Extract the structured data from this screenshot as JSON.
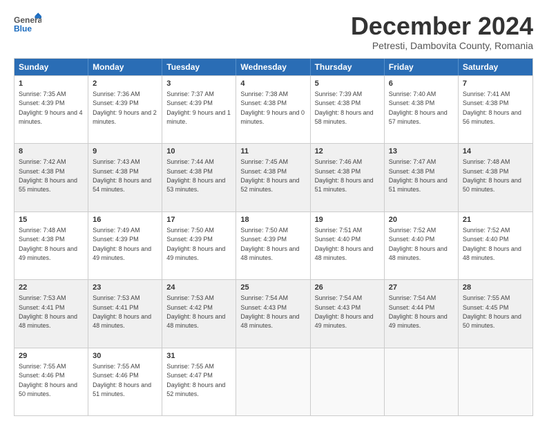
{
  "header": {
    "logo_general": "General",
    "logo_blue": "Blue",
    "month_title": "December 2024",
    "location": "Petresti, Dambovita County, Romania"
  },
  "days_of_week": [
    "Sunday",
    "Monday",
    "Tuesday",
    "Wednesday",
    "Thursday",
    "Friday",
    "Saturday"
  ],
  "weeks": [
    [
      {
        "day": "1",
        "sunrise": "Sunrise: 7:35 AM",
        "sunset": "Sunset: 4:39 PM",
        "daylight": "Daylight: 9 hours and 4 minutes.",
        "shaded": false
      },
      {
        "day": "2",
        "sunrise": "Sunrise: 7:36 AM",
        "sunset": "Sunset: 4:39 PM",
        "daylight": "Daylight: 9 hours and 2 minutes.",
        "shaded": false
      },
      {
        "day": "3",
        "sunrise": "Sunrise: 7:37 AM",
        "sunset": "Sunset: 4:39 PM",
        "daylight": "Daylight: 9 hours and 1 minute.",
        "shaded": false
      },
      {
        "day": "4",
        "sunrise": "Sunrise: 7:38 AM",
        "sunset": "Sunset: 4:38 PM",
        "daylight": "Daylight: 9 hours and 0 minutes.",
        "shaded": false
      },
      {
        "day": "5",
        "sunrise": "Sunrise: 7:39 AM",
        "sunset": "Sunset: 4:38 PM",
        "daylight": "Daylight: 8 hours and 58 minutes.",
        "shaded": false
      },
      {
        "day": "6",
        "sunrise": "Sunrise: 7:40 AM",
        "sunset": "Sunset: 4:38 PM",
        "daylight": "Daylight: 8 hours and 57 minutes.",
        "shaded": false
      },
      {
        "day": "7",
        "sunrise": "Sunrise: 7:41 AM",
        "sunset": "Sunset: 4:38 PM",
        "daylight": "Daylight: 8 hours and 56 minutes.",
        "shaded": false
      }
    ],
    [
      {
        "day": "8",
        "sunrise": "Sunrise: 7:42 AM",
        "sunset": "Sunset: 4:38 PM",
        "daylight": "Daylight: 8 hours and 55 minutes.",
        "shaded": true
      },
      {
        "day": "9",
        "sunrise": "Sunrise: 7:43 AM",
        "sunset": "Sunset: 4:38 PM",
        "daylight": "Daylight: 8 hours and 54 minutes.",
        "shaded": true
      },
      {
        "day": "10",
        "sunrise": "Sunrise: 7:44 AM",
        "sunset": "Sunset: 4:38 PM",
        "daylight": "Daylight: 8 hours and 53 minutes.",
        "shaded": true
      },
      {
        "day": "11",
        "sunrise": "Sunrise: 7:45 AM",
        "sunset": "Sunset: 4:38 PM",
        "daylight": "Daylight: 8 hours and 52 minutes.",
        "shaded": true
      },
      {
        "day": "12",
        "sunrise": "Sunrise: 7:46 AM",
        "sunset": "Sunset: 4:38 PM",
        "daylight": "Daylight: 8 hours and 51 minutes.",
        "shaded": true
      },
      {
        "day": "13",
        "sunrise": "Sunrise: 7:47 AM",
        "sunset": "Sunset: 4:38 PM",
        "daylight": "Daylight: 8 hours and 51 minutes.",
        "shaded": true
      },
      {
        "day": "14",
        "sunrise": "Sunrise: 7:48 AM",
        "sunset": "Sunset: 4:38 PM",
        "daylight": "Daylight: 8 hours and 50 minutes.",
        "shaded": true
      }
    ],
    [
      {
        "day": "15",
        "sunrise": "Sunrise: 7:48 AM",
        "sunset": "Sunset: 4:38 PM",
        "daylight": "Daylight: 8 hours and 49 minutes.",
        "shaded": false
      },
      {
        "day": "16",
        "sunrise": "Sunrise: 7:49 AM",
        "sunset": "Sunset: 4:39 PM",
        "daylight": "Daylight: 8 hours and 49 minutes.",
        "shaded": false
      },
      {
        "day": "17",
        "sunrise": "Sunrise: 7:50 AM",
        "sunset": "Sunset: 4:39 PM",
        "daylight": "Daylight: 8 hours and 49 minutes.",
        "shaded": false
      },
      {
        "day": "18",
        "sunrise": "Sunrise: 7:50 AM",
        "sunset": "Sunset: 4:39 PM",
        "daylight": "Daylight: 8 hours and 48 minutes.",
        "shaded": false
      },
      {
        "day": "19",
        "sunrise": "Sunrise: 7:51 AM",
        "sunset": "Sunset: 4:40 PM",
        "daylight": "Daylight: 8 hours and 48 minutes.",
        "shaded": false
      },
      {
        "day": "20",
        "sunrise": "Sunrise: 7:52 AM",
        "sunset": "Sunset: 4:40 PM",
        "daylight": "Daylight: 8 hours and 48 minutes.",
        "shaded": false
      },
      {
        "day": "21",
        "sunrise": "Sunrise: 7:52 AM",
        "sunset": "Sunset: 4:40 PM",
        "daylight": "Daylight: 8 hours and 48 minutes.",
        "shaded": false
      }
    ],
    [
      {
        "day": "22",
        "sunrise": "Sunrise: 7:53 AM",
        "sunset": "Sunset: 4:41 PM",
        "daylight": "Daylight: 8 hours and 48 minutes.",
        "shaded": true
      },
      {
        "day": "23",
        "sunrise": "Sunrise: 7:53 AM",
        "sunset": "Sunset: 4:41 PM",
        "daylight": "Daylight: 8 hours and 48 minutes.",
        "shaded": true
      },
      {
        "day": "24",
        "sunrise": "Sunrise: 7:53 AM",
        "sunset": "Sunset: 4:42 PM",
        "daylight": "Daylight: 8 hours and 48 minutes.",
        "shaded": true
      },
      {
        "day": "25",
        "sunrise": "Sunrise: 7:54 AM",
        "sunset": "Sunset: 4:43 PM",
        "daylight": "Daylight: 8 hours and 48 minutes.",
        "shaded": true
      },
      {
        "day": "26",
        "sunrise": "Sunrise: 7:54 AM",
        "sunset": "Sunset: 4:43 PM",
        "daylight": "Daylight: 8 hours and 49 minutes.",
        "shaded": true
      },
      {
        "day": "27",
        "sunrise": "Sunrise: 7:54 AM",
        "sunset": "Sunset: 4:44 PM",
        "daylight": "Daylight: 8 hours and 49 minutes.",
        "shaded": true
      },
      {
        "day": "28",
        "sunrise": "Sunrise: 7:55 AM",
        "sunset": "Sunset: 4:45 PM",
        "daylight": "Daylight: 8 hours and 50 minutes.",
        "shaded": true
      }
    ],
    [
      {
        "day": "29",
        "sunrise": "Sunrise: 7:55 AM",
        "sunset": "Sunset: 4:46 PM",
        "daylight": "Daylight: 8 hours and 50 minutes.",
        "shaded": false
      },
      {
        "day": "30",
        "sunrise": "Sunrise: 7:55 AM",
        "sunset": "Sunset: 4:46 PM",
        "daylight": "Daylight: 8 hours and 51 minutes.",
        "shaded": false
      },
      {
        "day": "31",
        "sunrise": "Sunrise: 7:55 AM",
        "sunset": "Sunset: 4:47 PM",
        "daylight": "Daylight: 8 hours and 52 minutes.",
        "shaded": false
      },
      {
        "day": "",
        "sunrise": "",
        "sunset": "",
        "daylight": "",
        "shaded": false,
        "empty": true
      },
      {
        "day": "",
        "sunrise": "",
        "sunset": "",
        "daylight": "",
        "shaded": false,
        "empty": true
      },
      {
        "day": "",
        "sunrise": "",
        "sunset": "",
        "daylight": "",
        "shaded": false,
        "empty": true
      },
      {
        "day": "",
        "sunrise": "",
        "sunset": "",
        "daylight": "",
        "shaded": false,
        "empty": true
      }
    ]
  ]
}
